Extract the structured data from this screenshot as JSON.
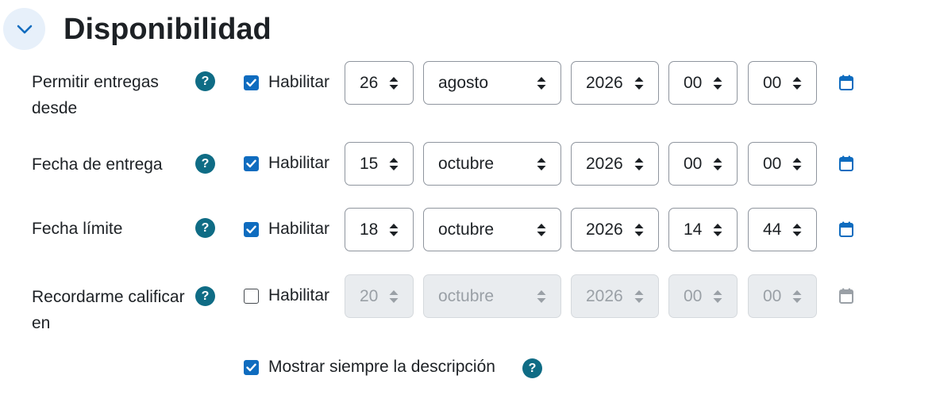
{
  "section": {
    "title": "Disponibilidad",
    "toggle_icon": "chevron-down-icon"
  },
  "colors": {
    "accent": "#0f6cbf",
    "help": "#0f6c85",
    "toggle_bg": "#e7f0fa",
    "disabled_bg": "#e9ecef"
  },
  "rows": [
    {
      "label": "Permitir entregas desde",
      "enabled": true,
      "enable_label": "Habilitar",
      "day": "26",
      "month": "agosto",
      "year": "2026",
      "hour": "00",
      "minute": "00"
    },
    {
      "label": "Fecha de entrega",
      "enabled": true,
      "enable_label": "Habilitar",
      "day": "15",
      "month": "octubre",
      "year": "2026",
      "hour": "00",
      "minute": "00"
    },
    {
      "label": "Fecha límite",
      "enabled": true,
      "enable_label": "Habilitar",
      "day": "18",
      "month": "octubre",
      "year": "2026",
      "hour": "14",
      "minute": "44"
    },
    {
      "label": "Recordarme calificar en",
      "enabled": false,
      "enable_label": "Habilitar",
      "day": "20",
      "month": "octubre",
      "year": "2026",
      "hour": "00",
      "minute": "00"
    }
  ],
  "always_show_description": {
    "label": "Mostrar siempre la descripción",
    "checked": true
  }
}
